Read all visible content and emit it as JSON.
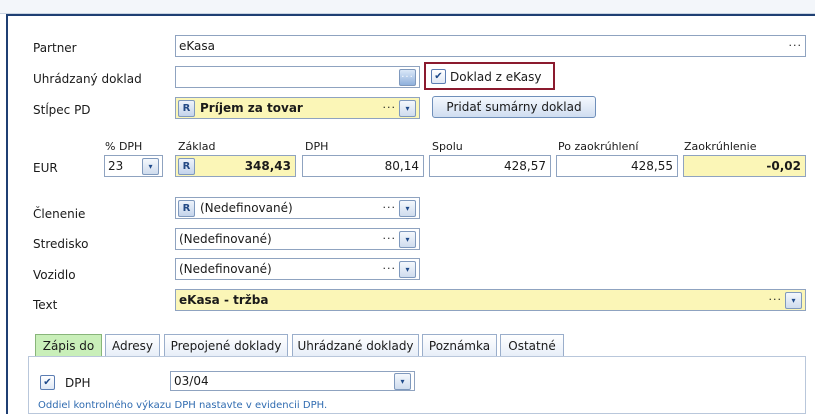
{
  "labels": {
    "partner": "Partner",
    "paid_doc": "Uhrádzaný doklad",
    "column": "Stĺpec PD",
    "currency": "EUR",
    "breakdown": "Členenie",
    "center": "Stredisko",
    "vehicle": "Vozidlo",
    "text": "Text"
  },
  "partner_value": "eKasa",
  "ekasa_checkbox": {
    "label": "Doklad z eKasy",
    "checked": true
  },
  "column_value": "Príjem za tovar",
  "add_summary_button": "Pridať sumárny doklad",
  "amounts": {
    "vat_rate_header": "% DPH",
    "vat_rate": "23",
    "base_header": "Základ",
    "base": "348,43",
    "vat_header": "DPH",
    "vat": "80,14",
    "total_header": "Spolu",
    "total": "428,57",
    "rounded_header": "Po zaokrúhlení",
    "rounded": "428,55",
    "rounding_header": "Zaokrúhlenie",
    "rounding": "-0,02"
  },
  "breakdown_value": "(Nedefinované)",
  "center_value": "(Nedefinované)",
  "vehicle_value": "(Nedefinované)",
  "text_value": "eKasa - tržba",
  "icons": {
    "ellipsis": "···",
    "dropdown": "▾",
    "check": "✔",
    "r_badge": "R"
  },
  "tabs": [
    {
      "label": "Zápis do",
      "active": true
    },
    {
      "label": "Adresy"
    },
    {
      "label": "Prepojené doklady"
    },
    {
      "label": "Uhrádzané doklady"
    },
    {
      "label": "Poznámka"
    },
    {
      "label": "Ostatné"
    }
  ],
  "tab_content": {
    "vat_checkbox_label": "DPH",
    "vat_period": "03/04",
    "note": "Oddiel kontrolného výkazu DPH nastavte v evidencii DPH."
  },
  "colors": {
    "accent_yellow": "#fbf6b7",
    "active_tab": "#c9efb9",
    "highlight_border": "#8b1a2e",
    "note_blue": "#2f6bb0"
  }
}
